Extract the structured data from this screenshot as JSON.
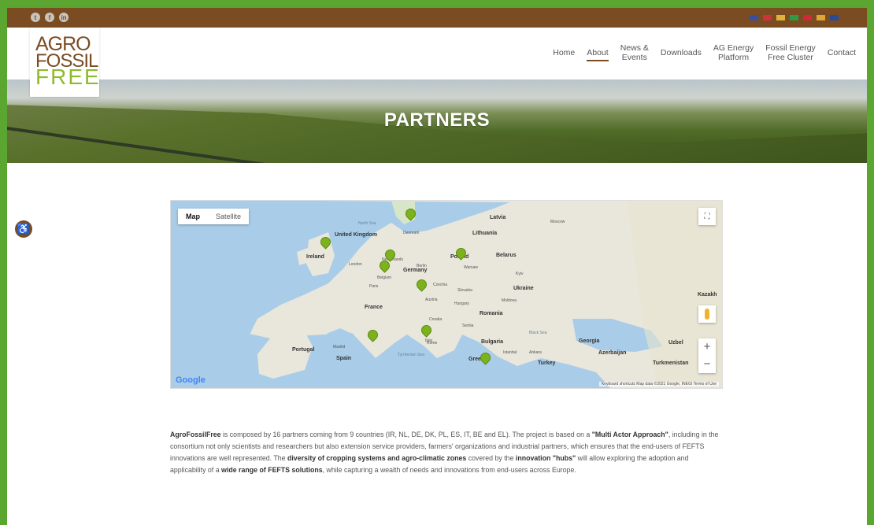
{
  "social": [
    "t",
    "f",
    "in"
  ],
  "flags": [
    {
      "name": "en-flag",
      "color": "#3b4ea0"
    },
    {
      "name": "pl-flag",
      "color": "#d0323c"
    },
    {
      "name": "de-flag",
      "color": "#e1b23a"
    },
    {
      "name": "it-flag",
      "color": "#2f9a46"
    },
    {
      "name": "dk-flag",
      "color": "#d12a36"
    },
    {
      "name": "es-flag",
      "color": "#e0a630"
    },
    {
      "name": "nl-flag",
      "color": "#2a4b95"
    }
  ],
  "brand": {
    "line1": "AGRO",
    "line2": "FOSSIL",
    "line3": "FREE",
    "brown": "#7b4b22",
    "green": "#8dbb2c"
  },
  "nav": [
    {
      "label": "Home",
      "active": false
    },
    {
      "label": "About",
      "active": true
    },
    {
      "label": "News &\nEvents",
      "active": false
    },
    {
      "label": "Downloads",
      "active": false
    },
    {
      "label": "AG Energy\nPlatform",
      "active": false
    },
    {
      "label": "Fossil Energy\nFree Cluster",
      "active": false
    },
    {
      "label": "Contact",
      "active": false
    }
  ],
  "hero": {
    "title": "PARTNERS"
  },
  "map": {
    "type_buttons": [
      "Map",
      "Satellite"
    ],
    "zoom_in": "+",
    "zoom_out": "−",
    "logo": "Google",
    "attribution": "Keyboard shortcuts   Map data ©2021 Google, INEGI   Terms of Use",
    "labels": {
      "united_kingdom": "United\nKingdom",
      "ireland": "Ireland",
      "denmark": "Denmark",
      "latvia": "Latvia",
      "lithuania": "Lithuania",
      "belarus": "Belarus",
      "poland": "Poland",
      "germany": "Germany",
      "netherlands": "Netherlands",
      "belgium": "Belgium",
      "czechia": "Czechia",
      "slovakia": "Slovakia",
      "austria": "Austria",
      "hungary": "Hungary",
      "ukraine": "Ukraine",
      "moldova": "Moldova",
      "romania": "Romania",
      "france": "France",
      "croatia": "Croatia",
      "serbia": "Serbia",
      "italy": "Italy",
      "bulgaria": "Bulgaria",
      "portugal": "Portugal",
      "spain": "Spain",
      "greece": "Greece",
      "turkey": "Turkey",
      "georgia": "Georgia",
      "azerbaijan": "Azerbaijan",
      "turkmenistan": "Turkmenistan",
      "kazakh": "Kazakh",
      "uzbek": "Uzbel",
      "black_sea": "Black Sea",
      "north_sea": "North Sea",
      "tyrrhenian": "Tyrrhenian Sea",
      "london": "London",
      "paris": "Paris",
      "berlin": "Berlin",
      "warsaw": "Warsaw",
      "kyiv": "Kyiv",
      "madrid": "Madrid",
      "rome": "Rome",
      "istanbul": "Istanbul",
      "ankara": "Ankara",
      "moscow": "Moscow"
    },
    "pins": [
      "Denmark",
      "Ireland",
      "Netherlands",
      "Belgium",
      "Poland",
      "Germany",
      "Spain",
      "Italy",
      "Greece"
    ]
  },
  "body": {
    "p1": "AgroFossilFree",
    "p2": " is composed by 16 partners coming from 9 countries (IR, NL, DE, DK, PL, ES, IT, BE and EL). The project is based on a ",
    "p3": "\"Multi Actor Approach\"",
    "p4": ", including in the consortium not only scientists and researchers but also extension service providers, farmers' organizations and industrial partners, which ensures that the end-users of FEFTS innovations are well represented. The ",
    "p5": "diversity of cropping systems and agro-climatic zones",
    "p6": " covered by the ",
    "p7": "innovation \"hubs\"",
    "p8": " will allow exploring the adoption and applicability of a ",
    "p9": "wide range of FEFTS solutions",
    "p10": ", while capturing a wealth of needs and innovations from end-users across Europe."
  }
}
